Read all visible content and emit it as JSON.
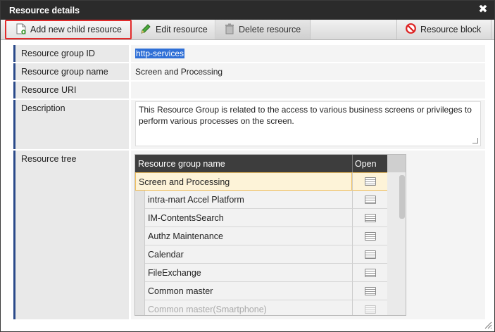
{
  "window": {
    "title": "Resource details",
    "close_symbol": "✖"
  },
  "toolbar": {
    "add_label": "Add new child resource",
    "edit_label": "Edit resource",
    "delete_label": "Delete resource",
    "block_label": "Resource block"
  },
  "fields": {
    "group_id": {
      "label": "Resource group ID",
      "value": "http-services"
    },
    "group_name": {
      "label": "Resource group name",
      "value": "Screen and Processing"
    },
    "uri": {
      "label": "Resource URI",
      "value": ""
    },
    "description": {
      "label": "Description",
      "value": "This Resource Group is related to the access to various business screens or privileges to perform various processes on the screen."
    },
    "tree": {
      "label": "Resource tree"
    }
  },
  "tree": {
    "col_name": "Resource group name",
    "col_open": "Open",
    "rows": [
      {
        "name": "Screen and Processing"
      },
      {
        "name": "intra-mart Accel Platform"
      },
      {
        "name": "IM-ContentsSearch"
      },
      {
        "name": "Authz Maintenance"
      },
      {
        "name": "Calendar"
      },
      {
        "name": "FileExchange"
      },
      {
        "name": "Common master"
      },
      {
        "name": "Common master(Smartphone)"
      }
    ]
  },
  "colors": {
    "titlebar": "#2b2b2b",
    "highlight_border": "#e22b2b",
    "label_accent": "#2b4a8a",
    "selection": "#2f6fd6"
  }
}
